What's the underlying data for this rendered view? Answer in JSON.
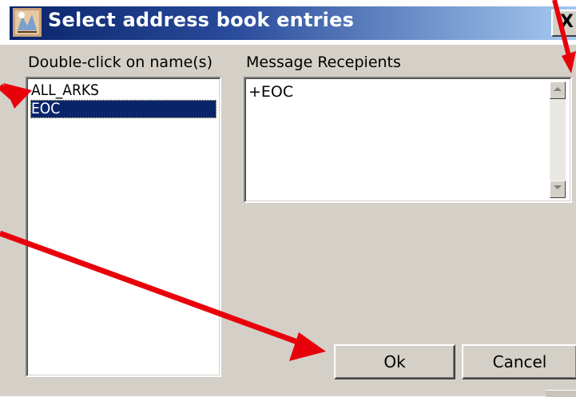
{
  "window": {
    "title": "Select address book entries",
    "close_label": "X"
  },
  "left_panel": {
    "label": "Double-click on name(s)",
    "items": [
      {
        "label": "ALL_ARKS",
        "selected": false
      },
      {
        "label": "EOC",
        "selected": true
      }
    ]
  },
  "right_panel": {
    "label": "Message Recepients",
    "recipients_text": "+EOC"
  },
  "buttons": {
    "ok_label": "Ok",
    "cancel_label": "Cancel"
  },
  "annotation_color": "#e8000b",
  "selection_color": "#0a246a"
}
